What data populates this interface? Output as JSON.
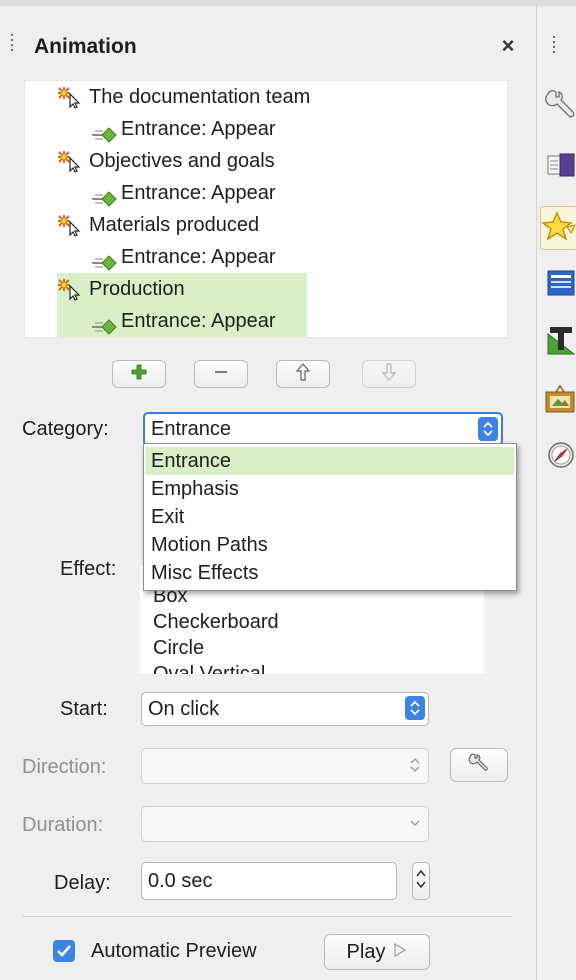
{
  "panel": {
    "title": "Animation",
    "close_glyph": "×"
  },
  "animation_list": [
    {
      "kind": "object",
      "label": "The documentation team",
      "selected": false,
      "icon": "custom-animation-icon"
    },
    {
      "kind": "effect",
      "label": "Entrance: Appear",
      "selected": false,
      "icon": "entrance-effect-icon"
    },
    {
      "kind": "object",
      "label": "Objectives and goals",
      "selected": false,
      "icon": "custom-animation-icon"
    },
    {
      "kind": "effect",
      "label": "Entrance: Appear",
      "selected": false,
      "icon": "entrance-effect-icon"
    },
    {
      "kind": "object",
      "label": "Materials produced",
      "selected": false,
      "icon": "custom-animation-icon"
    },
    {
      "kind": "effect",
      "label": "Entrance: Appear",
      "selected": false,
      "icon": "entrance-effect-icon"
    },
    {
      "kind": "object",
      "label": "Production",
      "selected": true,
      "icon": "custom-animation-icon"
    },
    {
      "kind": "effect",
      "label": "Entrance: Appear",
      "selected": true,
      "icon": "entrance-effect-icon"
    }
  ],
  "list_buttons": {
    "add_icon": "plus-icon",
    "remove_icon": "minus-icon",
    "move_up_icon": "arrow-up-icon",
    "move_down_icon": "arrow-down-icon"
  },
  "form": {
    "category_label": "Category:",
    "category_value": "Entrance",
    "effect_label": "Effect:",
    "start_label": "Start:",
    "start_value": "On click",
    "direction_label": "Direction:",
    "direction_value": "",
    "duration_label": "Duration:",
    "duration_value": "",
    "delay_label": "Delay:",
    "delay_value": "0.0 sec"
  },
  "category_options": [
    {
      "label": "Entrance",
      "selected": true
    },
    {
      "label": "Emphasis",
      "selected": false
    },
    {
      "label": "Exit",
      "selected": false
    },
    {
      "label": "Motion Paths",
      "selected": false
    },
    {
      "label": "Misc Effects",
      "selected": false
    }
  ],
  "effect_items": [
    "Box",
    "Checkerboard",
    "Circle",
    "Oval Vertical"
  ],
  "footer": {
    "auto_preview_label": "Automatic Preview",
    "auto_preview_checked": true,
    "play_label": "Play",
    "play_icon": "play-icon"
  },
  "sidebar_tabs": [
    {
      "icon": "properties-icon"
    },
    {
      "icon": "slide-transition-icon"
    },
    {
      "icon": "animation-icon",
      "active": true
    },
    {
      "icon": "master-slides-icon"
    },
    {
      "icon": "styles-icon"
    },
    {
      "icon": "gallery-icon"
    },
    {
      "icon": "navigator-icon"
    }
  ],
  "colors": {
    "selection": "#d9efc8",
    "accent": "#3d84e0",
    "panel_bg": "#efefef"
  }
}
